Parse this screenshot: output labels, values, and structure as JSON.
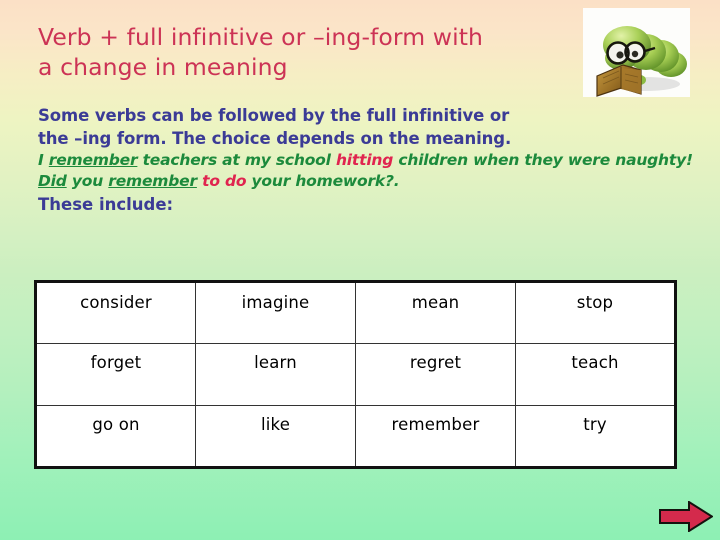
{
  "slide": {
    "background_top_color": "#fbe0c6",
    "background_mid_color": "#ccefc0",
    "background_bottom_color": "#8df0b4"
  },
  "title": {
    "color": "#cc3355",
    "line1": "Verb + full infinitive or –ing-form with",
    "line2": "a change in meaning"
  },
  "body": {
    "intro_color": "#3b3b96",
    "example_color": "#1c8a3c",
    "highlight_color": "#e0244f",
    "line1": "Some verbs can be  followed by the full infinitive or",
    "line2": "the –ing form. The choice depends on the meaning.",
    "example1": {
      "part1": "I ",
      "verb1": "remember",
      "part2": " teachers at my school ",
      "highlight1": "hitting",
      "part3": " children when they were naughty!"
    },
    "example2": {
      "verb1": "Did",
      "part1": " you ",
      "verb2": "remember",
      "part2": " ",
      "highlight1": "to do",
      "part3": " your homework?."
    },
    "line_final": "These include:"
  },
  "illustration": {
    "name": "bookworm-reading-illustration",
    "description": "green caterpillar with glasses reading a book",
    "body_color": "#8cc63f",
    "book_color": "#b07f2a"
  },
  "table": {
    "rows": [
      [
        "consider",
        "imagine",
        "mean",
        "stop"
      ],
      [
        "forget",
        "learn",
        "regret",
        "teach"
      ],
      [
        "go on",
        "like",
        "remember",
        "try"
      ]
    ]
  },
  "navigation": {
    "next_arrow_label": "next-slide-arrow",
    "arrow_color": "#d42a4c"
  }
}
